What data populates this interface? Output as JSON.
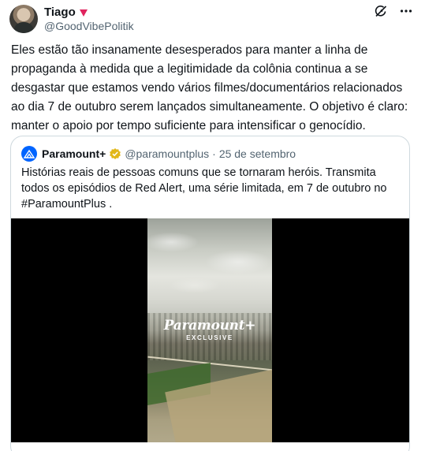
{
  "author": {
    "display_name": "Tiago",
    "handle": "@GoodVibePolitik"
  },
  "icons": {
    "name_badge": "red-heart-icon",
    "grok": "grok-icon",
    "more": "more-options-icon",
    "quote_logo": "paramount-logo-icon",
    "verified": "verified-gold-badge-icon"
  },
  "colors": {
    "heart": "#e0245e",
    "verified_gold": "#e2b719",
    "paramount_blue": "#0064ff"
  },
  "tweet": {
    "text": "Eles estão tão insanamente desesperados para manter a linha de propaganda à medida que a legitimidade da colônia continua a se desgastar que estamos vendo vários filmes/documentários relacionados ao dia 7 de outubro serem lançados simultaneamente. O objetivo é claro: manter o apoio por tempo suficiente para intensificar o genocídio."
  },
  "quoted": {
    "display_name": "Paramount+",
    "handle": "@paramountplus",
    "separator": "·",
    "date": "25 de setembro",
    "text": "Histórias reais de pessoas comuns que se tornaram heróis. Transmita todos os episódios de Red Alert, uma série limitada, em 7 de outubro no #ParamountPlus .",
    "video_overlay": {
      "brand": "Paramount+",
      "label": "EXCLUSIVE"
    }
  }
}
